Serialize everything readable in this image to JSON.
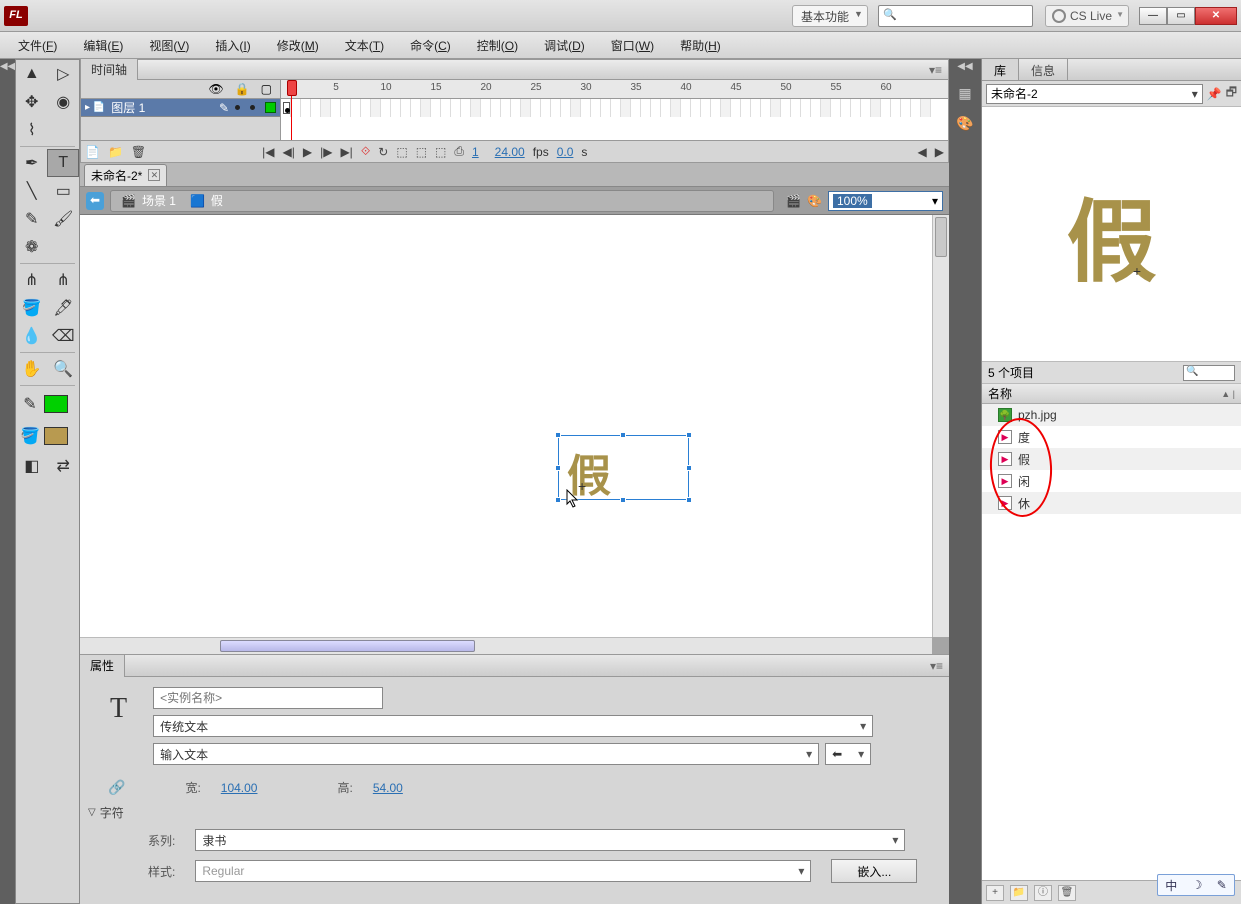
{
  "titlebar": {
    "workspace": "基本功能",
    "cslive": "CS Live"
  },
  "menubar": [
    {
      "l": "文件",
      "k": "F"
    },
    {
      "l": "编辑",
      "k": "E"
    },
    {
      "l": "视图",
      "k": "V"
    },
    {
      "l": "插入",
      "k": "I"
    },
    {
      "l": "修改",
      "k": "M"
    },
    {
      "l": "文本",
      "k": "T"
    },
    {
      "l": "命令",
      "k": "C"
    },
    {
      "l": "控制",
      "k": "O"
    },
    {
      "l": "调试",
      "k": "D"
    },
    {
      "l": "窗口",
      "k": "W"
    },
    {
      "l": "帮助",
      "k": "H"
    }
  ],
  "timeline": {
    "tab": "时间轴",
    "layer": "图层 1",
    "ruler": [
      5,
      10,
      15,
      20,
      25,
      30,
      35,
      40,
      45,
      50,
      55,
      60
    ],
    "fps_val": "24.00",
    "fps_unit": "fps",
    "time_val": "0.0",
    "time_unit": "s",
    "frame_val": "1"
  },
  "doc": {
    "tab": "未命名-2*",
    "crumb_scene": "场景 1",
    "crumb_symbol": "假",
    "zoom": "100%"
  },
  "stage": {
    "glyph": "假"
  },
  "props": {
    "tab": "属性",
    "instance_ph": "<实例名称>",
    "text_engine": "传统文本",
    "text_type": "输入文本",
    "w_lbl": "宽:",
    "w_val": "104.00",
    "h_lbl": "高:",
    "h_val": "54.00",
    "sect_char": "字符",
    "family_lbl": "系列:",
    "family_val": "隶书",
    "style_lbl": "样式:",
    "style_val": "Regular",
    "embed_btn": "嵌入..."
  },
  "lib": {
    "tab1": "库",
    "tab2": "信息",
    "doc": "未命名-2",
    "preview_glyph": "假",
    "count": "5 个项目",
    "col_name": "名称",
    "items": [
      {
        "ic": "tree",
        "n": "pzh.jpg"
      },
      {
        "ic": "sym",
        "n": "度"
      },
      {
        "ic": "sym",
        "n": "假"
      },
      {
        "ic": "sym",
        "n": "闲"
      },
      {
        "ic": "sym",
        "n": "休"
      }
    ]
  },
  "ime": {
    "a": "中",
    "b": "☽",
    "c": "✎"
  }
}
